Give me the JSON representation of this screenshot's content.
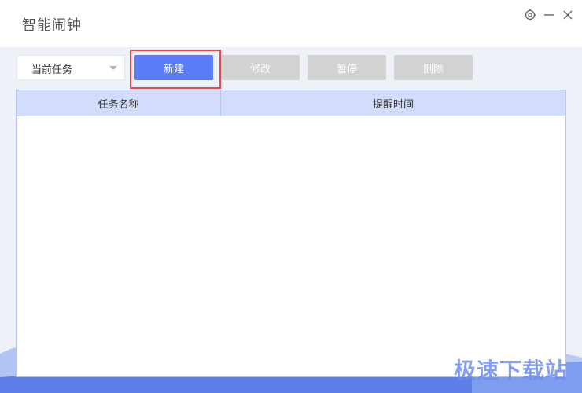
{
  "window": {
    "title": "智能闹钟"
  },
  "window_controls": {
    "settings_icon": "gear-icon",
    "minimize_icon": "minimize-icon",
    "close_icon": "close-icon"
  },
  "toolbar": {
    "filter_select": {
      "selected": "当前任务"
    },
    "new_label": "新建",
    "edit_label": "修改",
    "pause_label": "暂停",
    "delete_label": "删除"
  },
  "table": {
    "columns": [
      "任务名称",
      "提醒时间"
    ],
    "rows": []
  },
  "watermark": {
    "text": "极速下载站"
  },
  "colors": {
    "primary": "#5b7cf6",
    "disabled": "#d2d2d2",
    "header_bg": "#d3ddfb",
    "highlight": "#e04a4a"
  }
}
